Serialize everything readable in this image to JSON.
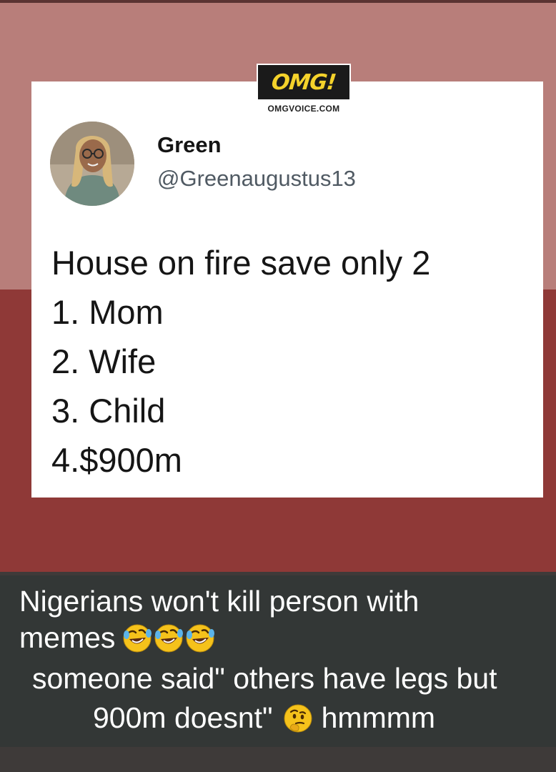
{
  "tweet": {
    "logo_text": "OMG!",
    "logo_site": "OMGVOICE.COM",
    "display_name": "Green",
    "handle": "@Greenaugustus13",
    "lines": [
      "House on fire save only 2",
      "1. Mom",
      "2. Wife",
      "3. Child",
      "4.$900m"
    ]
  },
  "caption": {
    "line1": "Nigerians won't kill person with",
    "line2": "memes",
    "line2_emoji": [
      "rolling-on-floor-laughing-emoji",
      "rolling-on-floor-laughing-emoji",
      "rolling-on-floor-laughing-emoji"
    ],
    "line3": "someone said\" others have legs but",
    "line4_a": "900m doesnt\"",
    "line4_emoji": "thinking-face-emoji",
    "line4_b": "hmmmm"
  },
  "colors": {
    "background_top": "#b87e7a",
    "background_bottom": "#8f3937",
    "caption_bg": "#333736",
    "logo_yellow": "#f4d22b"
  }
}
